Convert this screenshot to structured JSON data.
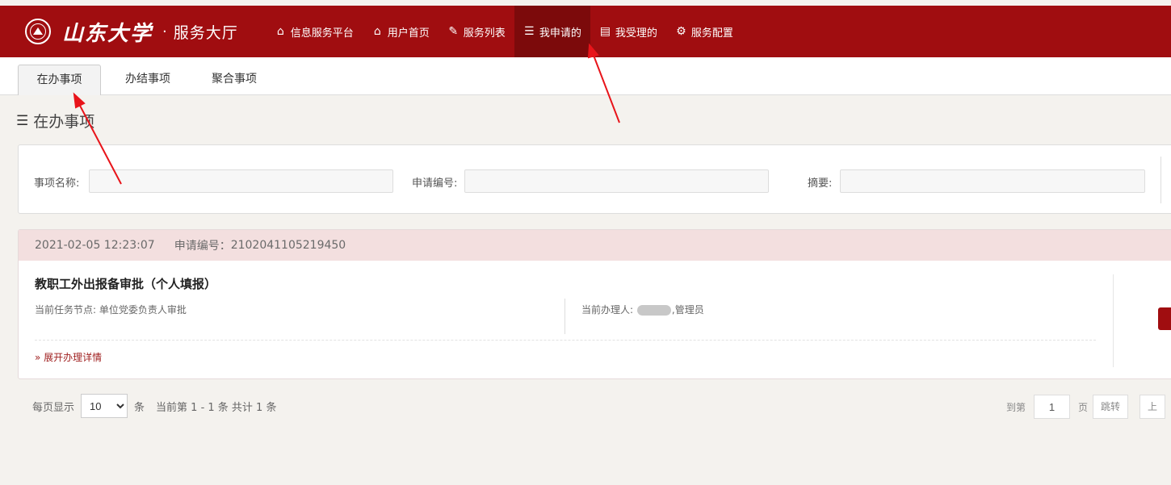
{
  "brand": {
    "calligraphy": "山东大学",
    "separator": "·",
    "title": "服务大厅"
  },
  "nav": [
    {
      "icon": "home-icon",
      "label": "信息服务平台",
      "active": false
    },
    {
      "icon": "home-icon",
      "label": "用户首页",
      "active": false
    },
    {
      "icon": "edit-icon",
      "label": "服务列表",
      "active": false
    },
    {
      "icon": "list-icon",
      "label": "我申请的",
      "active": true
    },
    {
      "icon": "tasks-icon",
      "label": "我受理的",
      "active": false
    },
    {
      "icon": "gears-icon",
      "label": "服务配置",
      "active": false
    }
  ],
  "tabs": [
    {
      "label": "在办事项",
      "active": true
    },
    {
      "label": "办结事项",
      "active": false
    },
    {
      "label": "聚合事项",
      "active": false
    }
  ],
  "section_title": "在办事项",
  "filters": {
    "name_label": "事项名称:",
    "name_value": "",
    "number_label": "申请编号:",
    "number_value": "",
    "summary_label": "摘要:",
    "summary_value": ""
  },
  "items": [
    {
      "datetime": "2021-02-05 12:23:07",
      "number_label": "申请编号：",
      "number": "2102041105219450",
      "title": "教职工外出报备审批（个人填报）",
      "node_label": "当前任务节点:",
      "node": "单位党委负责人审批",
      "handler_label": "当前办理人:",
      "handler_suffix": ",管理员",
      "expand_label": "展开办理详情"
    }
  ],
  "pagination": {
    "per_page_label": "每页显示",
    "per_page_value": "10",
    "unit": "条",
    "summary": "当前第 1 - 1 条 共计 1 条",
    "goto_label": "到第",
    "goto_value": "1",
    "page_unit": "页",
    "jump_label": "跳转",
    "prev_label": "上"
  },
  "colors": {
    "header": "#a00d10",
    "active_nav": "#7c0a0b",
    "row_head": "#f3dfdf",
    "annotation": "#e8141a"
  }
}
